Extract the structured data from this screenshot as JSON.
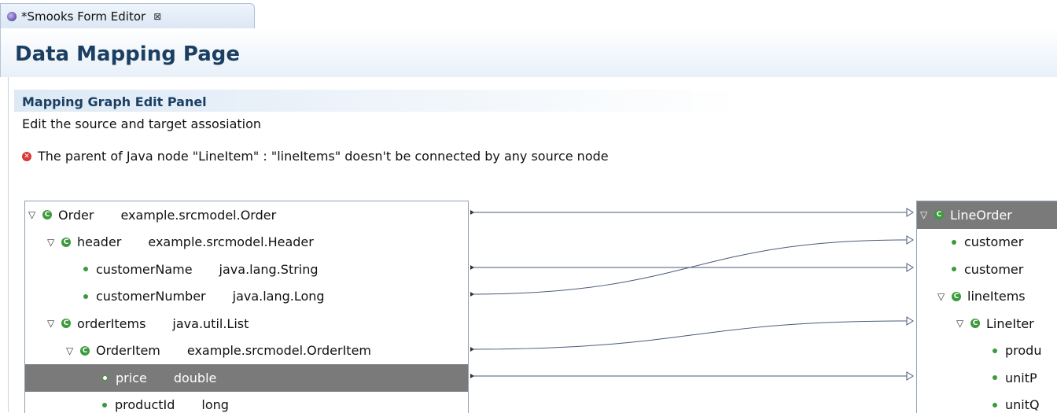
{
  "tab": {
    "label": "*Smooks Form Editor",
    "close_glyph": "⊠"
  },
  "page": {
    "title": "Data Mapping Page"
  },
  "section": {
    "title": "Mapping Graph Edit Panel",
    "description": "Edit the source and target assosiation",
    "error": "The parent of Java node \"LineItem\" : \"lineItems\" doesn't be connected by any source node"
  },
  "source_tree": [
    {
      "name": "Order",
      "type": "example.srcmodel.Order"
    },
    {
      "name": "header",
      "type": "example.srcmodel.Header"
    },
    {
      "name": "customerName",
      "type": "java.lang.String"
    },
    {
      "name": "customerNumber",
      "type": "java.lang.Long"
    },
    {
      "name": "orderItems",
      "type": "java.util.List"
    },
    {
      "name": "OrderItem",
      "type": "example.srcmodel.OrderItem"
    },
    {
      "name": "price",
      "type": "double"
    },
    {
      "name": "productId",
      "type": "long"
    }
  ],
  "target_tree": [
    {
      "name": "LineOrder"
    },
    {
      "name": "customer"
    },
    {
      "name": "customer"
    },
    {
      "name": "lineItems"
    },
    {
      "name": "LineIter"
    },
    {
      "name": "produ"
    },
    {
      "name": "unitP"
    },
    {
      "name": "unitQ"
    }
  ],
  "colors": {
    "class_icon": "#3c9a3c",
    "error_icon": "#d9383a",
    "selection": "#7a7a7a",
    "title": "#1b3f63"
  }
}
